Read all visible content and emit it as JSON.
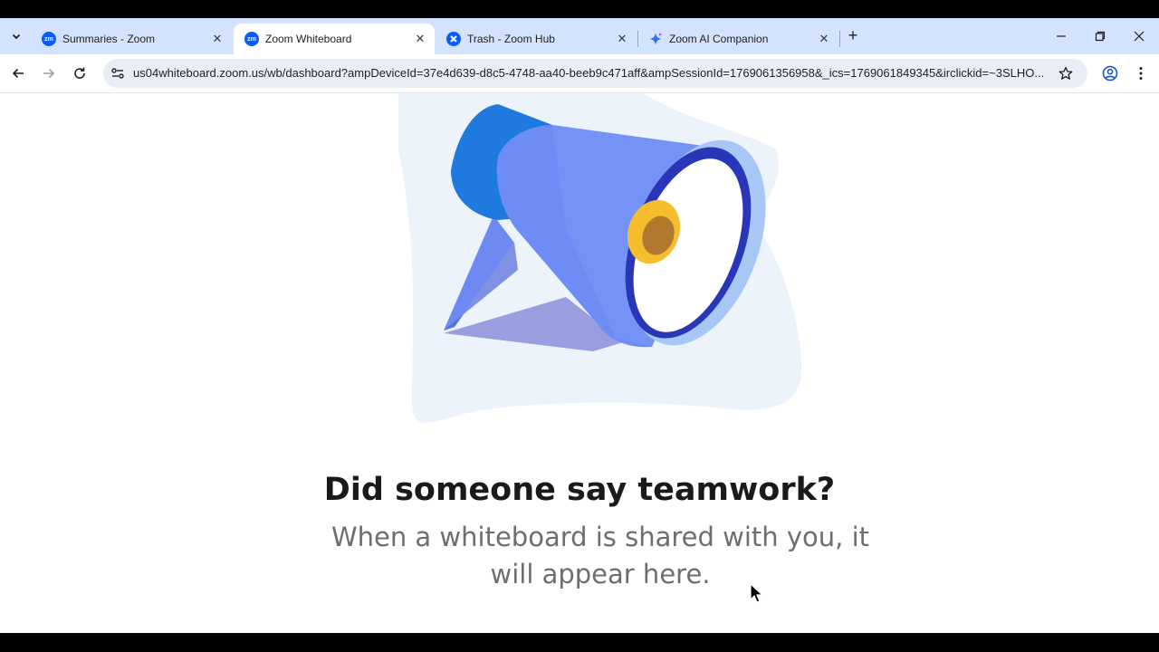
{
  "tabs": [
    {
      "title": "Summaries - Zoom",
      "favicon": "zoom-icon",
      "active": false
    },
    {
      "title": "Zoom Whiteboard",
      "favicon": "zoom-icon",
      "active": true
    },
    {
      "title": "Trash - Zoom Hub",
      "favicon": "zoom-hub-icon",
      "active": false
    },
    {
      "title": "Zoom AI Companion",
      "favicon": "ai-sparkle-icon",
      "active": false
    }
  ],
  "favicon_text": "zm",
  "address_bar": {
    "url": "us04whiteboard.zoom.us/wb/dashboard?ampDeviceId=37e4d639-d8c5-4748-aa40-beeb9c471aff&ampSessionId=1769061356958&_ics=1769061849345&irclickid=~3SLHO..."
  },
  "empty_state": {
    "title": "Did someone say teamwork?",
    "message": "When a whiteboard is shared with you, it will appear here."
  },
  "colors": {
    "tabstrip_bg": "#d3e3fd",
    "zoom_blue": "#0b5cff",
    "omnibox_bg": "#e9eef6"
  }
}
